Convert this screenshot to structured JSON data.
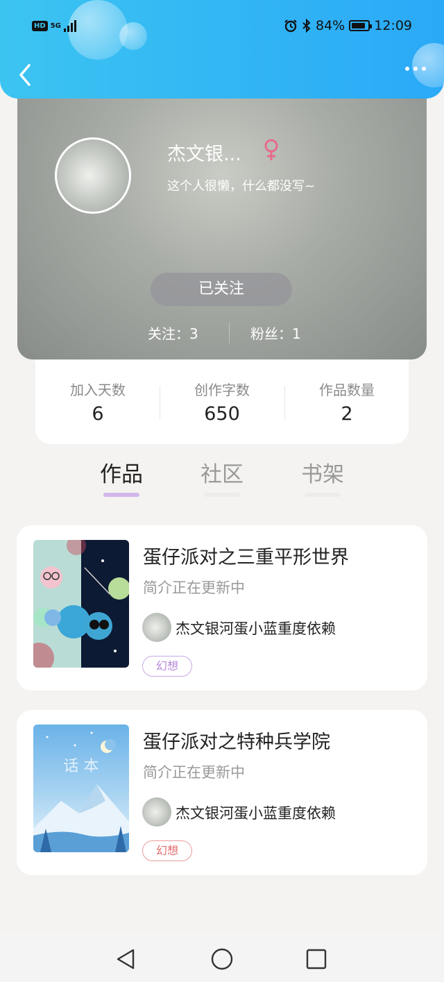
{
  "status_bar": {
    "network_badge": "HD",
    "network_type": "5G",
    "battery_percent": "84%",
    "time": "12:09",
    "icons": [
      "alarm-icon",
      "bluetooth-icon",
      "battery-icon"
    ]
  },
  "header": {
    "back_icon": "chevron-left-icon",
    "more_icon": "more-dots-icon",
    "gradient_colors": [
      "#3cc4f1",
      "#2aa9f7"
    ]
  },
  "profile": {
    "name": "杰文银...",
    "gender_symbol": "♀",
    "bio": "这个人很懒，什么都没写~",
    "follow_button": "已关注",
    "following": "关注：3",
    "followers": "粉丝：1"
  },
  "stats": [
    {
      "label": "加入天数",
      "value": "6"
    },
    {
      "label": "创作字数",
      "value": "650"
    },
    {
      "label": "作品数量",
      "value": "2"
    }
  ],
  "tabs": [
    {
      "label": "作品",
      "active": true
    },
    {
      "label": "社区",
      "active": false
    },
    {
      "label": "书架",
      "active": false
    }
  ],
  "works": [
    {
      "title": "蛋仔派对之三重平形世界",
      "description": "简介正在更新中",
      "author": "杰文银河蛋小蓝重度依赖",
      "tag": "幻想",
      "tag_color": "#b58ad8"
    },
    {
      "title": "蛋仔派对之特种兵学院",
      "description": "简介正在更新中",
      "author": "杰文银河蛋小蓝重度依赖",
      "tag": "幻想",
      "tag_color": "#e06c6c",
      "cover_text": "话 本"
    }
  ],
  "colors": {
    "accent_tab": "#d3b6ea",
    "background": "#f4f3f1",
    "gender_pink": "#e86b8a"
  },
  "nav_bar": {
    "icons": [
      "back-triangle-icon",
      "home-circle-icon",
      "recents-square-icon"
    ]
  }
}
